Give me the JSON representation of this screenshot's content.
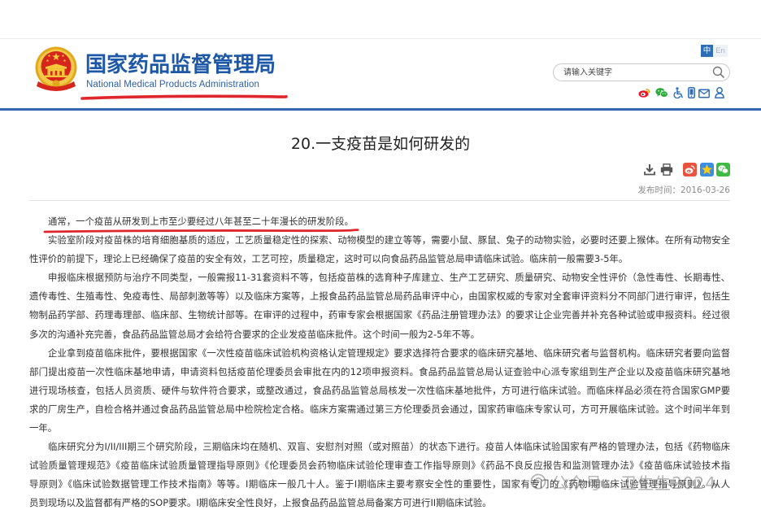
{
  "header": {
    "site_title": "国家药品监督管理局",
    "site_subtitle": "National Medical Products Administration",
    "lang_zh": "中",
    "lang_en": "En",
    "search_placeholder": "请输入关键字",
    "icons": {
      "emblem": "national-emblem-icon",
      "search": "search-icon",
      "links": [
        "weibo-icon",
        "wechat-icon",
        "accessibility-icon",
        "mobile-icon",
        "mail-icon",
        "user-icon"
      ]
    }
  },
  "article": {
    "title": "20.一支疫苗是如何研发的",
    "publish_label": "发布时间：",
    "publish_date": "2016-03-26",
    "tool_icons": [
      "download-icon",
      "print-icon"
    ],
    "share_icons": [
      "weibo-share-icon",
      "qzone-share-icon",
      "wechat-share-icon"
    ],
    "paragraphs": [
      {
        "lines": [
          "通常，一个疫苗从研发到上市至少要经过八年甚至二十年漫长的研发阶段。"
        ]
      },
      {
        "lines": [
          "实验室阶段对疫苗株的培育细胞基质的适应，工艺质量稳定性的探索、动物模型的建立等等，需要小鼠、豚鼠、兔子的动物实验，必要时还要上猴体。在所有动物安全",
          "性评价的前提下，理论上已经确保了疫苗的安全有效，工艺可控，质量稳定，这时可以向食品药品监管总局申请临床试验。临床前一般需要3-5年。"
        ]
      },
      {
        "lines": [
          "申报临床根据预防与治疗不同类型，一般需报11-31套资料不等，包括疫苗株的选育种子库建立、生产工艺研究、质量研究、动物安全性评价（急性毒性、长期毒性、",
          "遗传毒性、生殖毒性、免疫毒性、局部刺激等等）以及临床方案等，上报食品药品监管总局药品审评中心，由国家权威的专家对全套审评资料分不同部门进行审评，包括生",
          "物制品药学部、药理毒理部、临床部、生物统计部等。在审评的过程中，药审专家会根据国家《药品注册管理办法》的要求让企业完善并补充各种试验或申报资料。经过很",
          "多次的沟通补充完善，食品药品监管总局才会给符合要求的企业发疫苗临床批件。这个时间一般为2-5年不等。"
        ]
      },
      {
        "lines": [
          "企业拿到疫苗临床批件，要根据国家《一次性疫苗临床试验机构资格认定管理规定》要求选择符合要求的临床研究基地、临床研究者与监督机构。临床研究者要向监督",
          "部门提出疫苗一次性临床基地申请，申请资料包括疫苗伦理委员会审批在内的12项申报资料。食品药品监管总局认证查验中心派专家组到生产企业以及疫苗临床研究基地",
          "进行现场核查，包括人员资质、硬件与软件符合要求，或整改通过，食品药品监管总局核发一次性临床基地批件，方可进行临床试验。而临床样品必须在符合国家GMP要",
          "求的厂房生产，自检合格并通过食品药品监管总局中检院检定合格。临床方案需通过第三方伦理委员会通过，国家药审临床专家认可，方可开展临床试验。这个时间半年到",
          "一年。"
        ]
      },
      {
        "lines": [
          "临床研究分为I/II/III期三个研究阶段，三期临床均在随机、双盲、安慰剂对照（或对照苗）的状态下进行。疫苗人体临床试验国家有严格的管理办法，包括《药物临床",
          "试验质量管理规范》《疫苗临床试验质量管理指导原则》《伦理委员会药物临床试验伦理审查工作指导原则》《药品不良反应报告和监测管理办法》《疫苗临床试验技术指",
          "导原则》《临床试验数据管理工作技术指南》等等。I期临床一般几十人。鉴于I期临床主要考察安全性的重要性，国家有专门的《药物Ⅰ期临床试验管理指导原则》。从人",
          "员到现场以及监督都有严格的SOP要求。I期临床安全性良好，上报食品药品监管总局备案方可进行II期临床试验。"
        ]
      }
    ]
  },
  "watermark": {
    "text": "公众号 · 卫生生2024",
    "icon": "official-account-icon"
  },
  "colors": {
    "brand_blue": "#1d58a7",
    "rule_blue": "#3466b2",
    "lang_active": "#2f6db7",
    "annotation_red": "#e0262d",
    "weibo_red": "#e8533f",
    "wechat_green": "#2aae3a"
  }
}
